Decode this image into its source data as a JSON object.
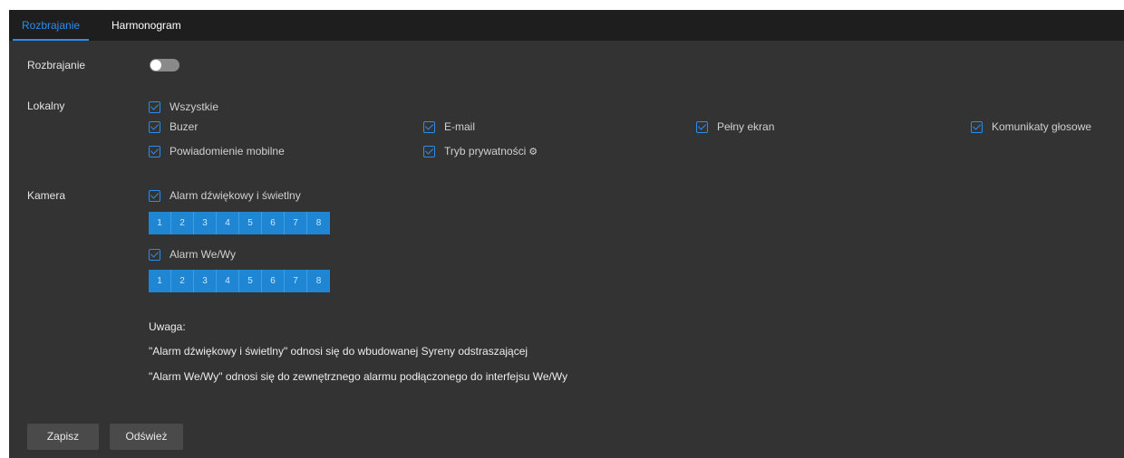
{
  "tabs": [
    {
      "label": "Rozbrajanie"
    },
    {
      "label": "Harmonogram"
    }
  ],
  "disarm": {
    "label": "Rozbrajanie",
    "enabled": false
  },
  "local": {
    "label": "Lokalny",
    "all_label": "Wszystkie",
    "options": [
      {
        "label": "Buzer",
        "checked": true
      },
      {
        "label": "E-mail",
        "checked": true
      },
      {
        "label": "Pełny ekran",
        "checked": true
      },
      {
        "label": "Komunikaty głosowe",
        "checked": true
      },
      {
        "label": "Powiadomienie mobilne",
        "checked": true
      },
      {
        "label": "Tryb prywatności",
        "checked": true
      }
    ]
  },
  "camera": {
    "label": "Kamera",
    "groups": [
      {
        "label": "Alarm dźwiękowy i świetlny",
        "checked": true,
        "channels": [
          "1",
          "2",
          "3",
          "4",
          "5",
          "6",
          "7",
          "8"
        ]
      },
      {
        "label": "Alarm We/Wy",
        "checked": true,
        "channels": [
          "1",
          "2",
          "3",
          "4",
          "5",
          "6",
          "7",
          "8"
        ]
      }
    ]
  },
  "notes": {
    "title": "Uwaga:",
    "line1": "\"Alarm dźwiękowy i świetlny\" odnosi się do wbudowanej Syreny odstraszającej",
    "line2": "\"Alarm We/Wy\" odnosi się do zewnętrznego alarmu podłączonego do interfejsu We/Wy"
  },
  "buttons": {
    "save": "Zapisz",
    "refresh": "Odśwież"
  },
  "colors": {
    "accent": "#2d8cf0",
    "channel_bg": "#1f86d3",
    "panel_bg": "#333333",
    "tabbar_bg": "#1e1e1e"
  }
}
